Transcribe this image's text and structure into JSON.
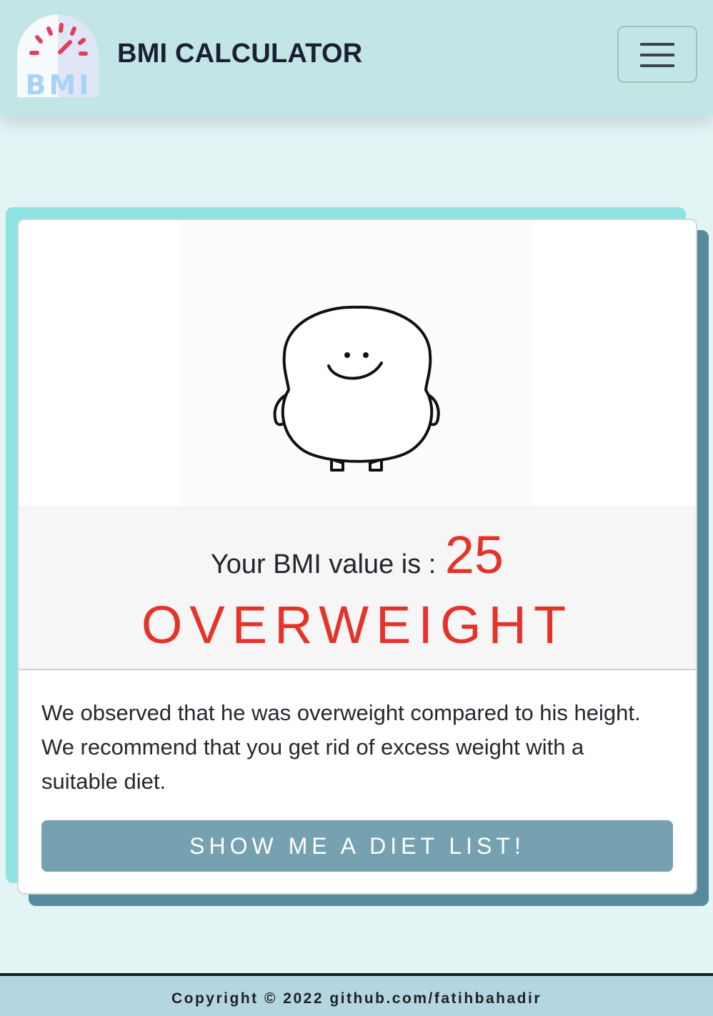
{
  "navbar": {
    "logo_text": "BMI",
    "title": "BMI CALCULATOR",
    "menu_icon": "hamburger-icon"
  },
  "result": {
    "image_icon": "smiling-blob-character",
    "bmi_label": "Your BMI value is :",
    "bmi_value": "25",
    "category": "OVERWEIGHT",
    "description": "We observed that he was overweight compared to his height. We recommend that you get rid of excess weight with a suitable diet.",
    "button_label": "SHOW ME A DIET LIST!"
  },
  "footer": {
    "text": "Copyright © 2022 github.com/fatihbahadir"
  },
  "colors": {
    "accent_red": "#e5332a",
    "navbar_bg": "#c2e5e6",
    "page_bg": "#e3f4f5",
    "button_bg": "#76a1b0",
    "accent_teal": "#8fe3e0",
    "shadow_teal": "#578a9d"
  }
}
